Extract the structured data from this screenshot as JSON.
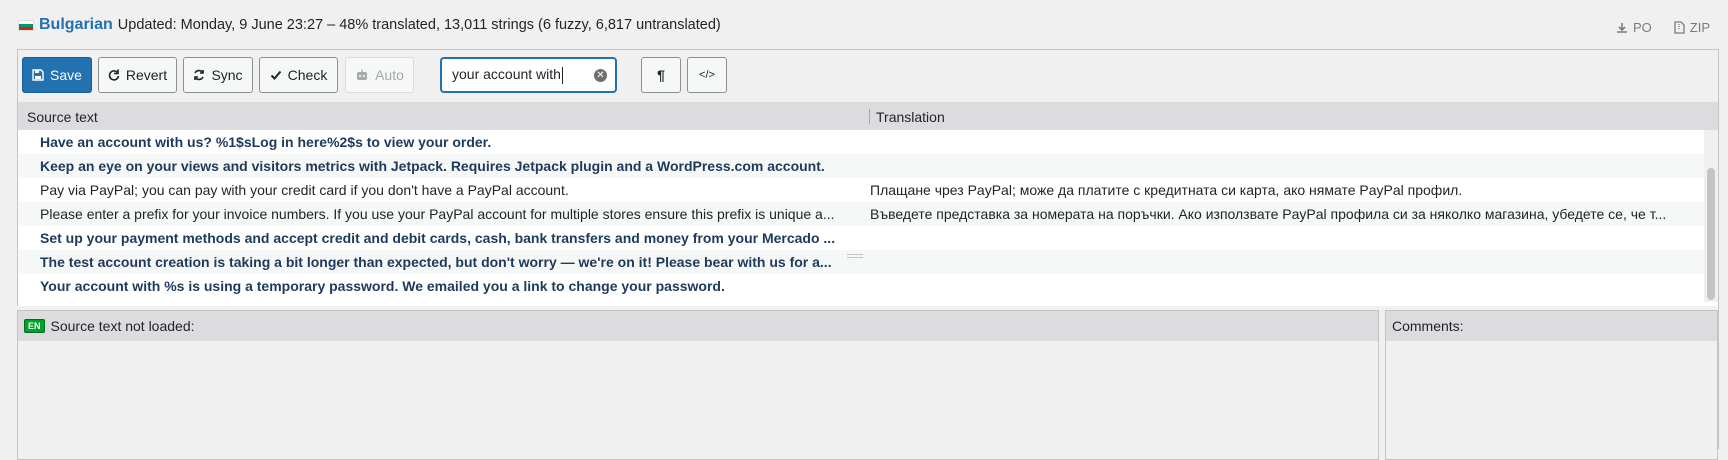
{
  "header": {
    "language": "Bulgarian",
    "status": "Updated: Monday, 9 June 23:27 – 48% translated, 13,011 strings (6 fuzzy, 6,817 untranslated)",
    "downloads": [
      {
        "label": "PO",
        "icon": "download-icon"
      },
      {
        "label": "ZIP",
        "icon": "file-zip-icon"
      }
    ],
    "flag_colors": [
      "#ffffff",
      "#00966e",
      "#d62612"
    ]
  },
  "toolbar": {
    "save": "Save",
    "revert": "Revert",
    "sync": "Sync",
    "check": "Check",
    "auto": "Auto",
    "search_value": "your account with",
    "pilcrow": "¶",
    "code": "</>"
  },
  "columns": {
    "source": "Source text",
    "translation": "Translation"
  },
  "rows": [
    {
      "source": "Have an account with us? %1$sLog in here%2$s to view your order.",
      "translation": "",
      "bold": true
    },
    {
      "source": "Keep an eye on your views and visitors metrics with Jetpack. Requires Jetpack plugin and a WordPress.com account.",
      "translation": "",
      "bold": true
    },
    {
      "source": "Pay via PayPal; you can pay with your credit card if you don't have a PayPal account.",
      "translation": "Плащане чрез PayPal; може да платите с кредитната си карта, ако нямате PayPal профил.",
      "bold": false
    },
    {
      "source": "Please enter a prefix for your invoice numbers. If you use your PayPal account for multiple stores ensure this prefix is unique a...",
      "translation": "Въведете представка за номерата на поръчки. Ако използвате PayPal профила си за няколко магазина, убедете се, че т...",
      "bold": false
    },
    {
      "source": "Set up your payment methods and accept credit and debit cards, cash, bank transfers and money from your Mercado ...",
      "translation": "",
      "bold": true
    },
    {
      "source": "The test account creation is taking a bit longer than expected, but don't worry — we're on it! Please bear with us for a...",
      "translation": "",
      "bold": true
    },
    {
      "source": "Your account with %s is using a temporary password. We emailed you a link to change your password.",
      "translation": "",
      "bold": true
    }
  ],
  "source_pane": {
    "badge": "EN",
    "title": "Source text not loaded:"
  },
  "comments_pane": {
    "title": "Comments:"
  },
  "colors": {
    "primary": "#2271b1",
    "row_bold": "#1d3a5c",
    "en_badge": "#00a32a"
  }
}
